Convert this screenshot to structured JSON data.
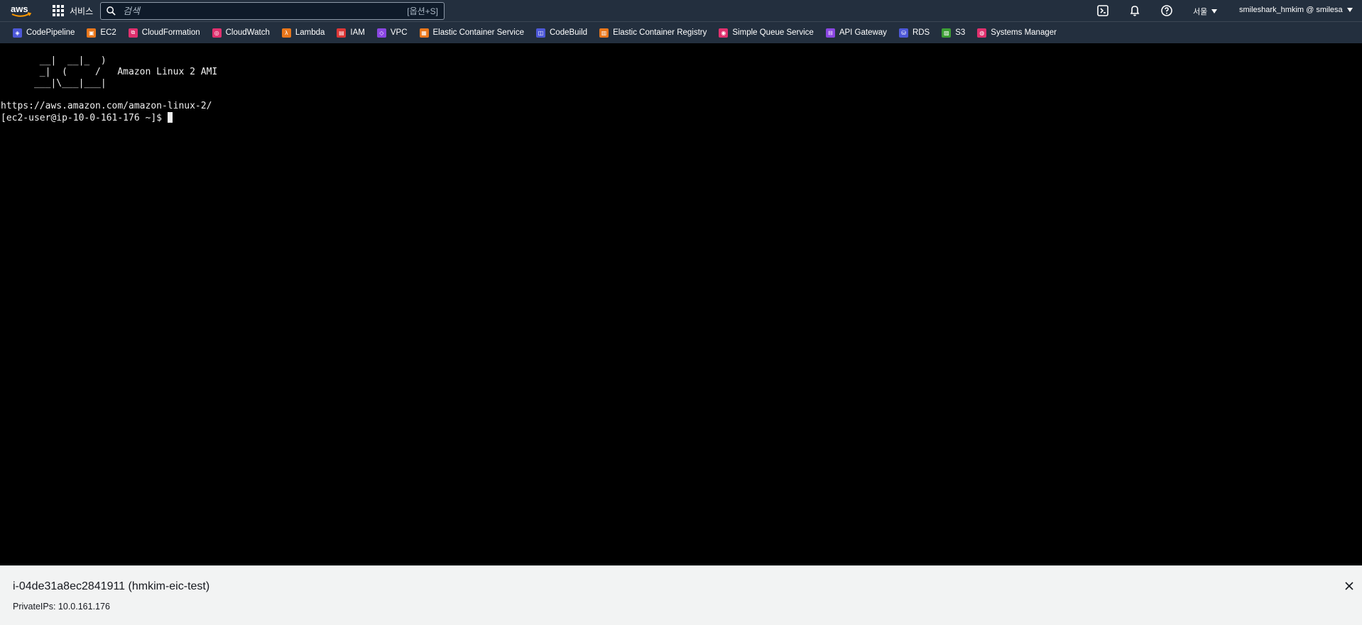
{
  "nav": {
    "logo_text": "aws",
    "services_label": "서비스",
    "search_placeholder": "검색",
    "search_shortcut": "[옵션+S]",
    "region": "서울",
    "account": "smileshark_hmkim @ smilesa",
    "icons": [
      "cloudshell-icon",
      "bell-icon",
      "help-icon"
    ]
  },
  "favorites": [
    {
      "label": "CodePipeline",
      "color": "#4d58d8",
      "glyph": "◈"
    },
    {
      "label": "EC2",
      "color": "#e8761b",
      "glyph": "▣"
    },
    {
      "label": "CloudFormation",
      "color": "#e0306e",
      "glyph": "⧉"
    },
    {
      "label": "CloudWatch",
      "color": "#e0306e",
      "glyph": "◎"
    },
    {
      "label": "Lambda",
      "color": "#e8761b",
      "glyph": "λ"
    },
    {
      "label": "IAM",
      "color": "#dd3636",
      "glyph": "▤"
    },
    {
      "label": "VPC",
      "color": "#8a46e2",
      "glyph": "◇"
    },
    {
      "label": "Elastic Container Service",
      "color": "#e8761b",
      "glyph": "▦"
    },
    {
      "label": "CodeBuild",
      "color": "#4d58d8",
      "glyph": "◫"
    },
    {
      "label": "Elastic Container Registry",
      "color": "#e8761b",
      "glyph": "▥"
    },
    {
      "label": "Simple Queue Service",
      "color": "#e0306e",
      "glyph": "◉"
    },
    {
      "label": "API Gateway",
      "color": "#8a46e2",
      "glyph": "⊟"
    },
    {
      "label": "RDS",
      "color": "#4d58d8",
      "glyph": "⛁"
    },
    {
      "label": "S3",
      "color": "#3c9e35",
      "glyph": "▨"
    },
    {
      "label": "Systems Manager",
      "color": "#e0306e",
      "glyph": "◍"
    }
  ],
  "terminal": {
    "banner": "       __|  __|_  )\n       _|  (     /   Amazon Linux 2 AMI\n      ___|\\___|___|",
    "url_line": "https://aws.amazon.com/amazon-linux-2/",
    "prompt": "[ec2-user@ip-10-0-161-176 ~]$ "
  },
  "instance": {
    "title": "i-04de31a8ec2841911 (hmkim-eic-test)",
    "private_ips": "PrivateIPs: 10.0.161.176"
  }
}
